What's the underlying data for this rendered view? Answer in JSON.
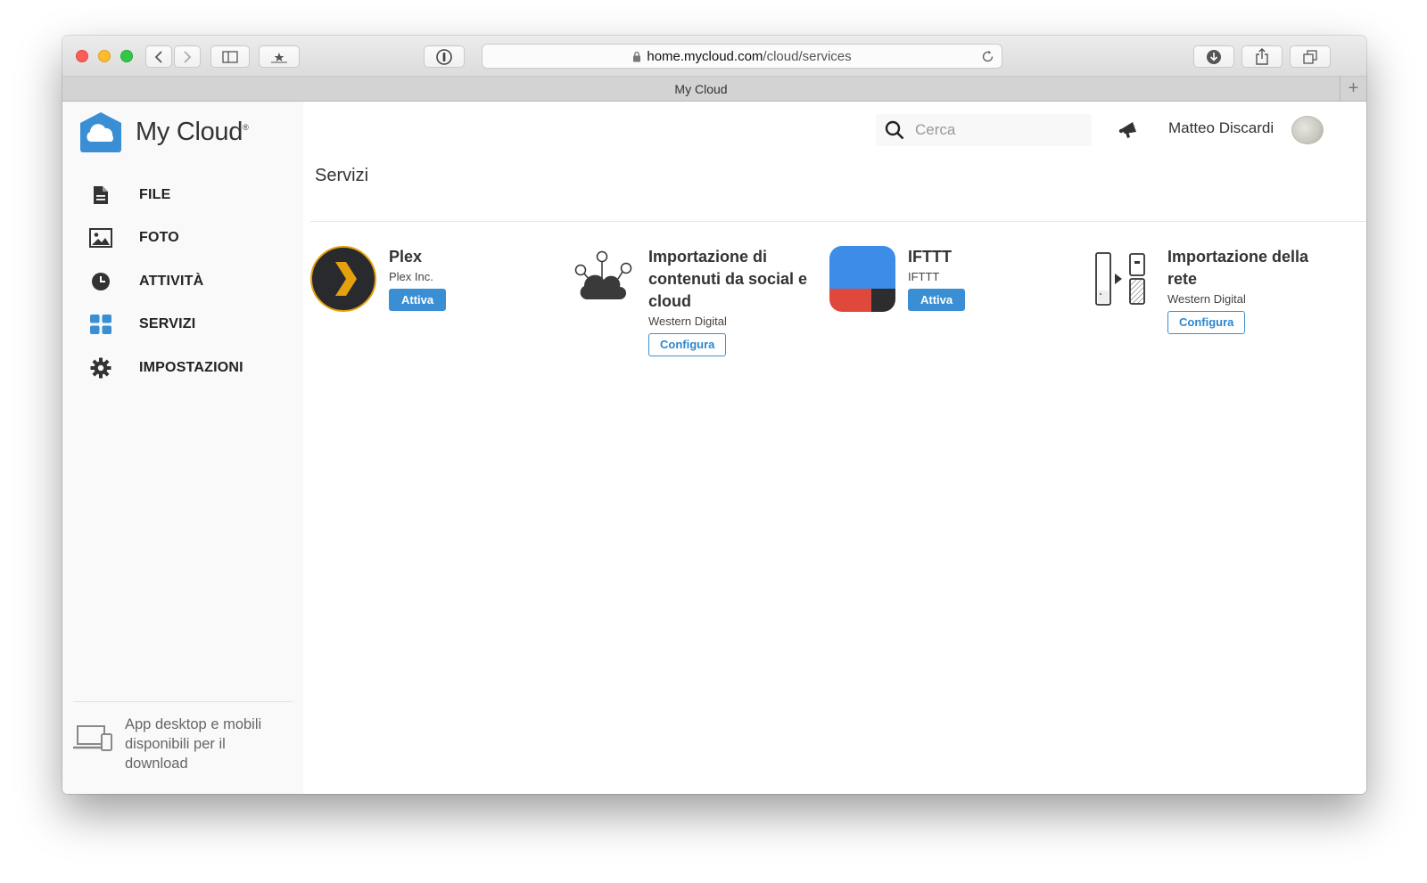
{
  "browser": {
    "url_host": "home.mycloud.com",
    "url_path": "/cloud/services",
    "tab_title": "My Cloud",
    "new_tab_label": "+"
  },
  "app": {
    "logo_text": "My Cloud",
    "logo_mark": "®",
    "brand_color": "#3a8fd4"
  },
  "sidebar": {
    "items": [
      {
        "label": "FILE",
        "icon": "file-icon"
      },
      {
        "label": "FOTO",
        "icon": "photo-icon"
      },
      {
        "label": "ATTIVITÀ",
        "icon": "clock-icon"
      },
      {
        "label": "SERVIZI",
        "icon": "grid-icon"
      },
      {
        "label": "IMPOSTAZIONI",
        "icon": "gear-icon"
      }
    ],
    "download_text": "App desktop e mobili disponibili per il download"
  },
  "header": {
    "search_placeholder": "Cerca",
    "user_name": "Matteo Discardi"
  },
  "main": {
    "title": "Servizi",
    "services": [
      {
        "name": "Plex",
        "vendor": "Plex Inc.",
        "action": "Attiva",
        "icon": "plex-icon"
      },
      {
        "name": "Importazione di contenuti da social e cloud",
        "vendor": "Western Digital",
        "action": "Configura",
        "icon": "cloud-import-icon"
      },
      {
        "name": "IFTTT",
        "vendor": "IFTTT",
        "action": "Attiva",
        "icon": "ifttt-icon"
      },
      {
        "name": "Importazione della rete",
        "vendor": "Western Digital",
        "action": "Configura",
        "icon": "network-import-icon"
      }
    ]
  }
}
